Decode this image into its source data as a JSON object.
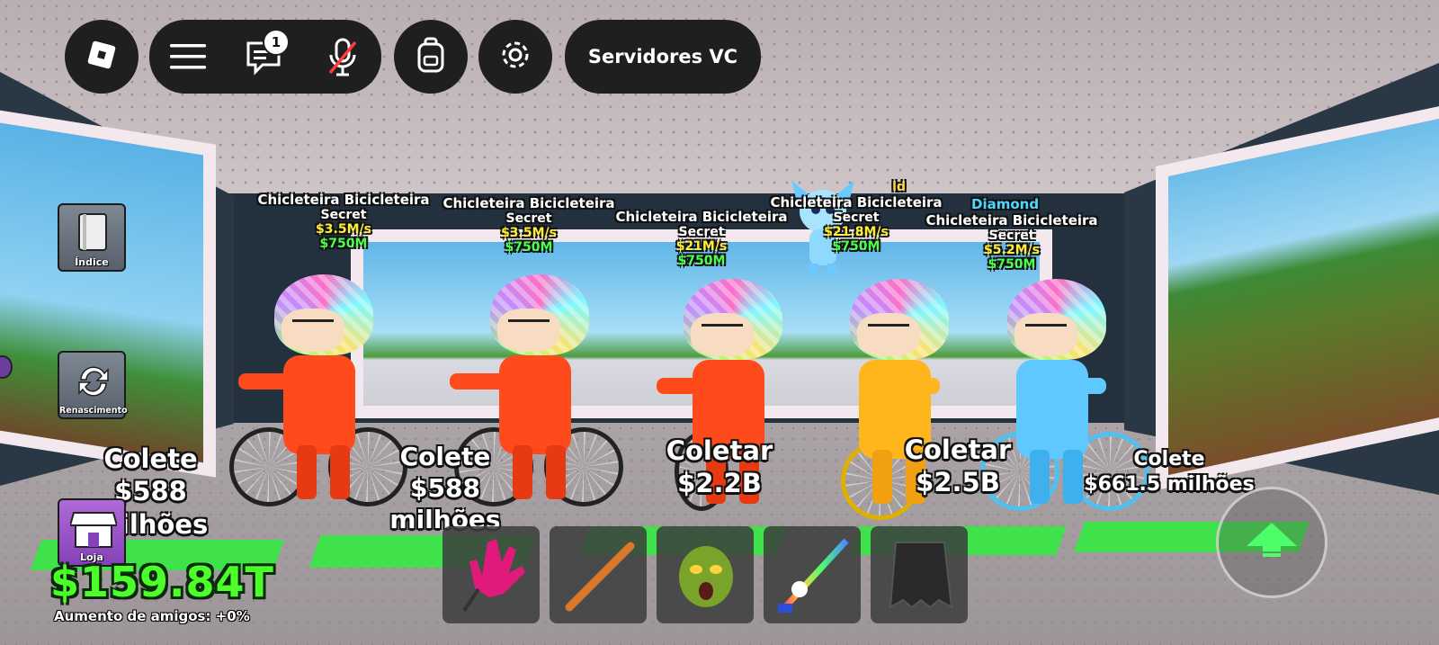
{
  "top_bar": {
    "chat_badge": "1",
    "servers_label": "Servidores VC",
    "icons": [
      "roblox-logo-icon",
      "menu-icon",
      "chat-icon",
      "mic-muted-icon",
      "backpack-icon",
      "gear-icon"
    ]
  },
  "side_menu": {
    "items": [
      {
        "label": "Índice",
        "icon": "book-icon"
      },
      {
        "label": "Renascimento",
        "icon": "refresh-icon"
      },
      {
        "label": "Loja",
        "icon": "shop-icon"
      }
    ]
  },
  "characters": [
    {
      "name": "Chicleteira Bicicleteira",
      "rarity": "Secret",
      "speed": "$3.5M/s",
      "price": "$750M",
      "collect_label": "Colete",
      "collect_value": "$588 milhões",
      "color": "#ff4a1c"
    },
    {
      "name": "Chicleteira Bicicleteira",
      "rarity": "Secret",
      "speed": "$3.5M/s",
      "price": "$750M",
      "collect_label": "Colete",
      "collect_value": "$588 milhões",
      "color": "#ff4a1c"
    },
    {
      "name": "Chicleteira Bicicleteira",
      "rarity": "Secret",
      "speed": "$21M/s",
      "price": "$750M",
      "collect_label": "Coletar",
      "collect_value": "$2.2B",
      "color": "#ff4a1c"
    },
    {
      "mutation": "ld",
      "name": "Chicleteira Bicicleteira",
      "rarity": "Secret",
      "speed": "$21.8M/s",
      "price": "$750M",
      "collect_label": "Coletar",
      "collect_value": "$2.5B",
      "color": "#ffb51c"
    },
    {
      "mutation": "Diamond",
      "name": "Chicleteira Bicicleteira",
      "rarity": "Secret",
      "speed": "$5.2M/s",
      "price": "$750M",
      "collect_label": "Colete",
      "collect_value": "$661.5 milhões",
      "color": "#5fc8ff"
    }
  ],
  "money": {
    "balance": "$159.84T",
    "friends_boost": "Aumento de amigos: +0%"
  },
  "hotbar": {
    "items": [
      "glove-icon",
      "bat-icon",
      "mask-icon",
      "unicorn-sword-icon",
      "cape-icon"
    ]
  },
  "jump_button_icon": "up-arrow-icon",
  "colors": {
    "money_green": "#4cff2a",
    "hud_dark": "#1f1f1f",
    "pad_green": "#3fe24a"
  }
}
